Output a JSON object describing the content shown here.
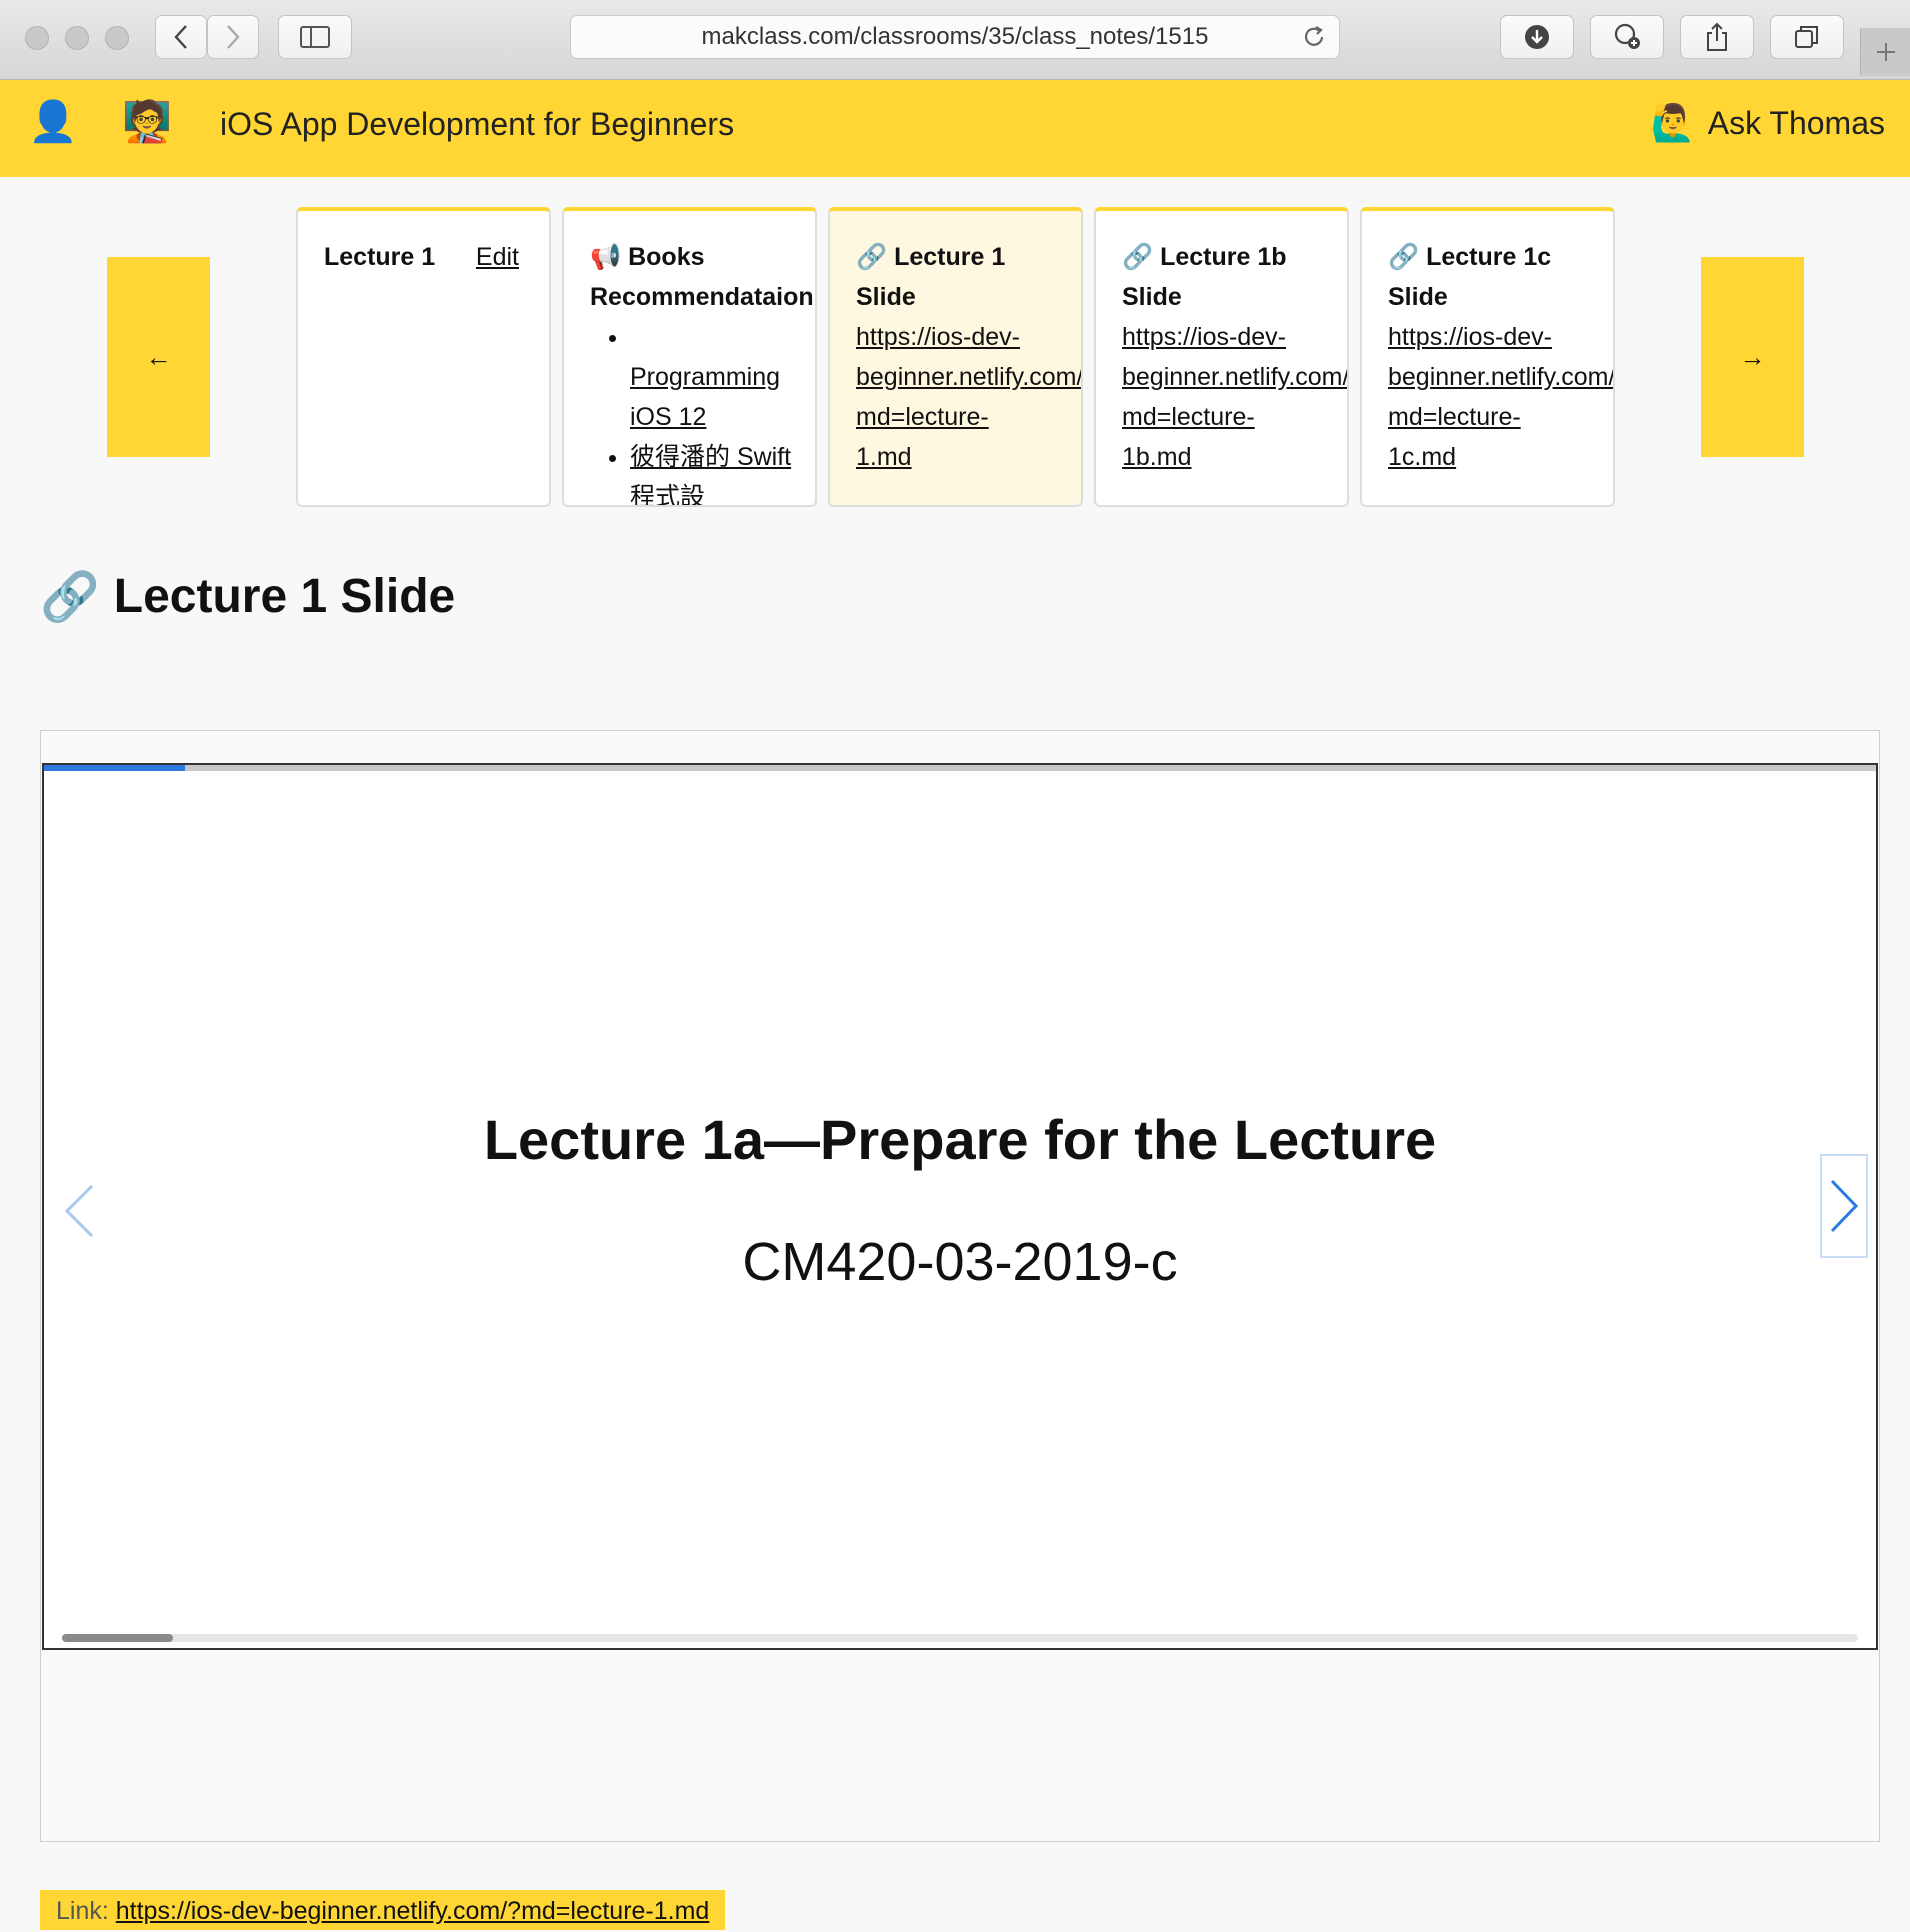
{
  "browser": {
    "url": "makclass.com/classrooms/35/class_notes/1515"
  },
  "header": {
    "profile_icon": "user-silhouette-icon",
    "teacher_icon": "teacher-emoji-icon",
    "course_title": "iOS App Development for Beginners",
    "ask_label": "Ask Thomas",
    "ask_icon": "raising-hand-emoji-icon",
    "accent_color": "#ffd633"
  },
  "carousel": {
    "prev_label": "←",
    "next_label": "→",
    "cards": [
      {
        "title": "Lecture 1",
        "edit": "Edit"
      },
      {
        "emoji": "📢",
        "title": "Books",
        "title2": "Recommendataion",
        "items": [
          "Programming iOS 12",
          "彼得潘的 Swift程式設"
        ]
      },
      {
        "emoji": "🔗",
        "title": "Lecture 1",
        "title2": "Slide",
        "link": [
          "https://ios-dev-",
          "beginner.netlify.com/?",
          "md=lecture-",
          "1.md"
        ]
      },
      {
        "emoji": "🔗",
        "title": "Lecture 1b",
        "title2": "Slide",
        "link": [
          "https://ios-dev-",
          "beginner.netlify.com/?",
          "md=lecture-",
          "1b.md"
        ]
      },
      {
        "emoji": "🔗",
        "title": "Lecture 1c",
        "title2": "Slide",
        "link": [
          "https://ios-dev-",
          "beginner.netlify.com/?",
          "md=lecture-",
          "1c.md"
        ]
      }
    ]
  },
  "section": {
    "emoji": "🔗",
    "heading": "Lecture 1 Slide"
  },
  "slide": {
    "title": "Lecture 1a—Prepare for the Lecture",
    "subtitle": "CM420-03-2019-c",
    "progress_fraction": 0.077,
    "scroll_fraction": 0.062
  },
  "link_bar": {
    "label": "Link:",
    "url": "https://ios-dev-beginner.netlify.com/?md=lecture-1.md"
  }
}
